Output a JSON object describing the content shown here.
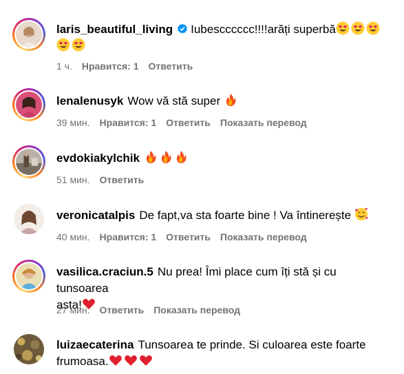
{
  "comments": [
    {
      "username": "laris_beautiful_living",
      "verified": true,
      "text": "Iubescccccc!!!!arăți superbă",
      "emojis": [
        "heart-eyes",
        "heart-eyes",
        "heart-eyes",
        "heart-eyes",
        "heart-eyes"
      ],
      "time": "1 ч.",
      "likes": "Нравится: 1",
      "reply": "Ответить",
      "translate": ""
    },
    {
      "username": "lenalenusyk",
      "text": "Wow vă stă super",
      "emojis": [
        "fire"
      ],
      "time": "39 мин.",
      "likes": "Нравится: 1",
      "reply": "Ответить",
      "translate": "Показать перевод"
    },
    {
      "username": "evdokiakylchik",
      "text": "",
      "emojis": [
        "fire",
        "fire",
        "fire"
      ],
      "time": "51 мин.",
      "likes": "",
      "reply": "Ответить",
      "translate": ""
    },
    {
      "username": "veronicatalpis",
      "text": "De fapt,va sta foarte bine ! Va întinerește",
      "emojis": [
        "smiling-hearts"
      ],
      "time": "40 мин.",
      "likes": "Нравится: 1",
      "reply": "Ответить",
      "translate": "Показать перевод"
    },
    {
      "username": "vasilica.craciun.5",
      "text_line1": "Nu prea! Îmi place cum îți stă și cu tunsoarea",
      "text_line2": "asta!",
      "emojis": [
        "red-heart"
      ],
      "time": "27 мин.",
      "likes": "",
      "reply": "Ответить",
      "translate": "Показать перевод"
    },
    {
      "username": "luizaecaterina",
      "text_line1": "Tunsoarea te prinde. Si culoarea este foarte",
      "text_line2": "frumoasa.",
      "emojis": [
        "red-heart",
        "red-heart",
        "red-heart"
      ]
    }
  ],
  "colors": {
    "meta_text": "#737373",
    "verified_badge": "#0095f6"
  }
}
